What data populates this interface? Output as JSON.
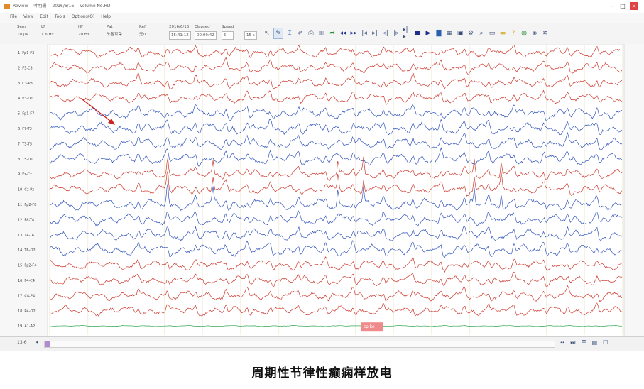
{
  "window": {
    "app_name": "Review",
    "title_parts": [
      "Review",
      "叶明珊",
      "2016/6/16",
      "Volume No.HD"
    ]
  },
  "menu": [
    "File",
    "View",
    "Edit",
    "Tools",
    "Options(O)",
    "Help"
  ],
  "toolbar": {
    "columns": [
      {
        "label": "Sens",
        "value": "10 μV"
      },
      {
        "label": "LF",
        "value": "1.6 Hz"
      },
      {
        "label": "HF",
        "value": "70 Hz"
      },
      {
        "label": "Pat",
        "value": "头各耳朵"
      },
      {
        "label": "Ref",
        "value": "无0"
      },
      {
        "label": "2016/6/16",
        "value": "15:41:12"
      },
      {
        "label": "Elapsed",
        "value": "00:00:42"
      },
      {
        "label": "Speed",
        "value": "5"
      },
      {
        "label": "",
        "value": "15 s"
      }
    ],
    "icons": [
      "pointer-icon",
      "marker-icon",
      "cursor-icon",
      "pen-icon",
      "print-icon",
      "chart-icon",
      "export-icon",
      "rewind-icon",
      "fast-forward-icon",
      "step-back-icon",
      "step-forward-icon",
      "play-back-icon",
      "play-forward-icon",
      "page-forward-icon",
      "stop-icon",
      "play-icon",
      "bar-chart-icon",
      "montage-icon",
      "video-icon",
      "settings-icon",
      "zoom-icon",
      "monitor-icon",
      "folder-icon",
      "help-icon",
      "globe-icon",
      "map-icon",
      "analysis-icon"
    ]
  },
  "channels": [
    {
      "num": "1",
      "label": "Fp1-F3",
      "color": "#cc3a2e"
    },
    {
      "num": "2",
      "label": "F3-C3",
      "color": "#cc3a2e"
    },
    {
      "num": "3",
      "label": "C3-P3",
      "color": "#cc3a2e"
    },
    {
      "num": "4",
      "label": "P3-O1",
      "color": "#cc3a2e"
    },
    {
      "num": "5",
      "label": "Fp1-F7",
      "color": "#3355bb"
    },
    {
      "num": "6",
      "label": "F7-T3",
      "color": "#3355bb"
    },
    {
      "num": "7",
      "label": "T3-T5",
      "color": "#3355bb"
    },
    {
      "num": "8",
      "label": "T5-O1",
      "color": "#3355bb"
    },
    {
      "num": "9",
      "label": "Fz-Cz",
      "color": "#cc3a2e"
    },
    {
      "num": "10",
      "label": "Cz-Pz",
      "color": "#cc3a2e"
    },
    {
      "num": "11",
      "label": "Fp2-F8",
      "color": "#3355bb"
    },
    {
      "num": "12",
      "label": "F8-T4",
      "color": "#3355bb"
    },
    {
      "num": "13",
      "label": "T4-T6",
      "color": "#3355bb"
    },
    {
      "num": "14",
      "label": "T6-O2",
      "color": "#3355bb"
    },
    {
      "num": "15",
      "label": "Fp2-F4",
      "color": "#cc3a2e"
    },
    {
      "num": "16",
      "label": "F4-C4",
      "color": "#cc3a2e"
    },
    {
      "num": "17",
      "label": "C4-P4",
      "color": "#cc3a2e"
    },
    {
      "num": "18",
      "label": "P4-O2",
      "color": "#cc3a2e"
    },
    {
      "num": "19",
      "label": "A1-A2",
      "color": "#33aa55"
    },
    {
      "num": "20",
      "label": "",
      "color": "#333333"
    }
  ],
  "event_marker": {
    "label": "spike",
    "color": "#ef8a8a"
  },
  "status": {
    "page": "13-6",
    "prev": "◂"
  },
  "caption": "周期性节律性癫痫样放电"
}
